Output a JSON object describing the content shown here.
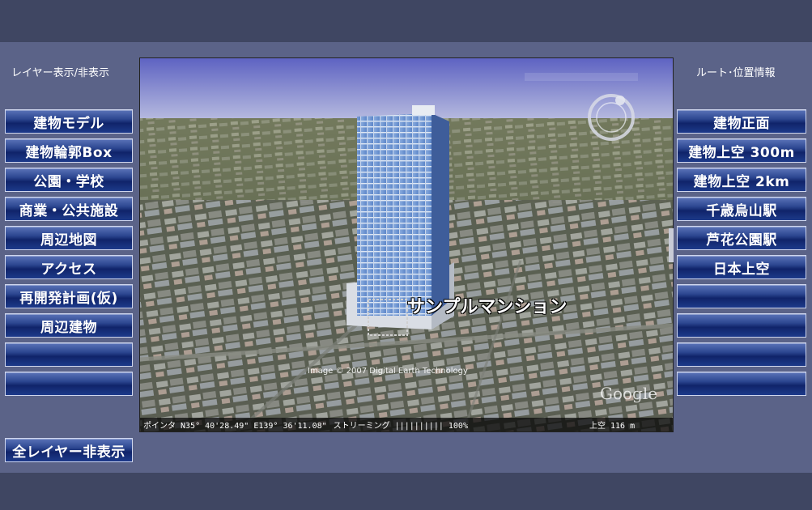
{
  "left_panel": {
    "title": "レイヤー表示/非表示",
    "buttons": [
      "建物モデル",
      "建物輪郭Box",
      "公園・学校",
      "商業・公共施設",
      "周辺地図",
      "アクセス",
      "再開発計画(仮)",
      "周辺建物",
      "",
      ""
    ],
    "hide_all": "全レイヤー非表示"
  },
  "right_panel": {
    "title": "ルート･位置情報",
    "buttons": [
      "建物正面",
      "建物上空 300m",
      "建物上空 2km",
      "千歳烏山駅",
      "芦花公園駅",
      "日本上空",
      "",
      "",
      "",
      ""
    ]
  },
  "viewer": {
    "placemark_label": "サンプルマンション",
    "image_credit": "Image © 2007 Digital Earth Technology",
    "logo": "Google",
    "status": {
      "pointer": "ポインタ N35° 40'28.49\" E139° 36'11.08\"",
      "streaming": "ストリーミング ||||||||||  100%",
      "altitude": "上空     116 m"
    }
  },
  "colors": {
    "background": "#5b6388",
    "bar": "#3f4662",
    "button_top": "#5a73b8",
    "button_bottom": "#10246a"
  }
}
